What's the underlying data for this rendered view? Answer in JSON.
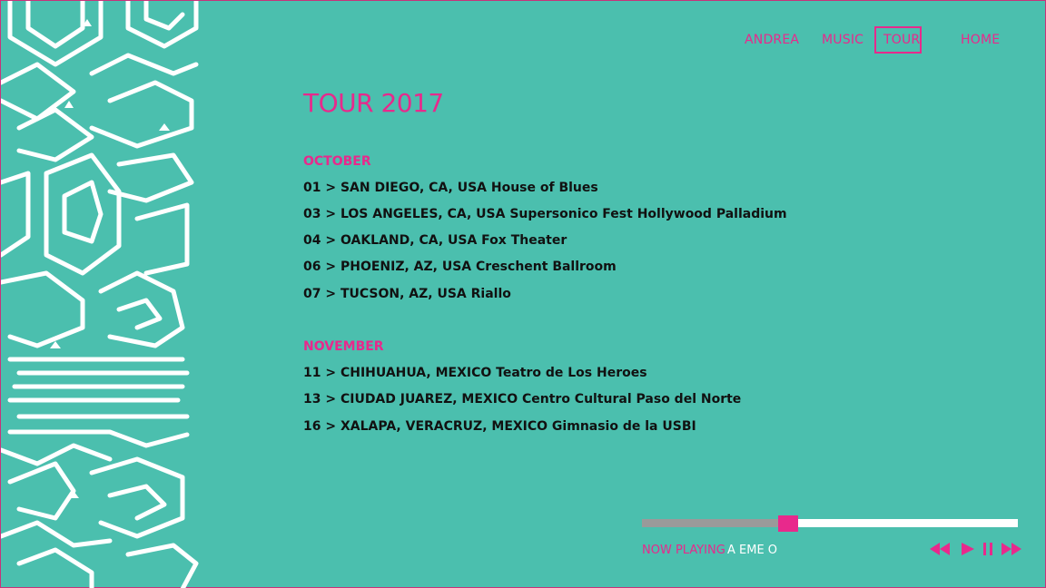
{
  "colors": {
    "background": "#4bbfae",
    "accent": "#e8298c",
    "text": "#111111",
    "pattern": "#ffffff"
  },
  "nav": {
    "items": [
      {
        "label": "ANDREA"
      },
      {
        "label": "MUSIC"
      },
      {
        "label": "TOUR",
        "active": true
      },
      {
        "label": "HOME"
      }
    ]
  },
  "page": {
    "title": "TOUR 2017"
  },
  "tour": {
    "months": [
      {
        "name": "OCTOBER",
        "dates": [
          "01 > SAN DIEGO, CA, USA House of Blues",
          "03 > LOS ANGELES, CA, USA Supersonico Fest Hollywood Palladium",
          "04 > OAKLAND, CA, USA Fox Theater",
          "06 > PHOENIZ, AZ, USA Creschent Ballroom",
          "07 > TUCSON, AZ, USA Riallo"
        ]
      },
      {
        "name": "NOVEMBER",
        "dates": [
          "11 > CHIHUAHUA, MEXICO Teatro de Los Heroes",
          "13 > CIUDAD JUAREZ, MEXICO Centro Cultural Paso del Norte",
          "16 > XALAPA, VERACRUZ, MEXICO Gimnasio de la USBI"
        ]
      }
    ]
  },
  "player": {
    "now_playing_label": "NOW PLAYING",
    "track_title": "A EME O",
    "progress": 0.39,
    "controls": [
      "rewind-icon",
      "play-icon",
      "pause-icon",
      "fast-forward-icon"
    ]
  }
}
